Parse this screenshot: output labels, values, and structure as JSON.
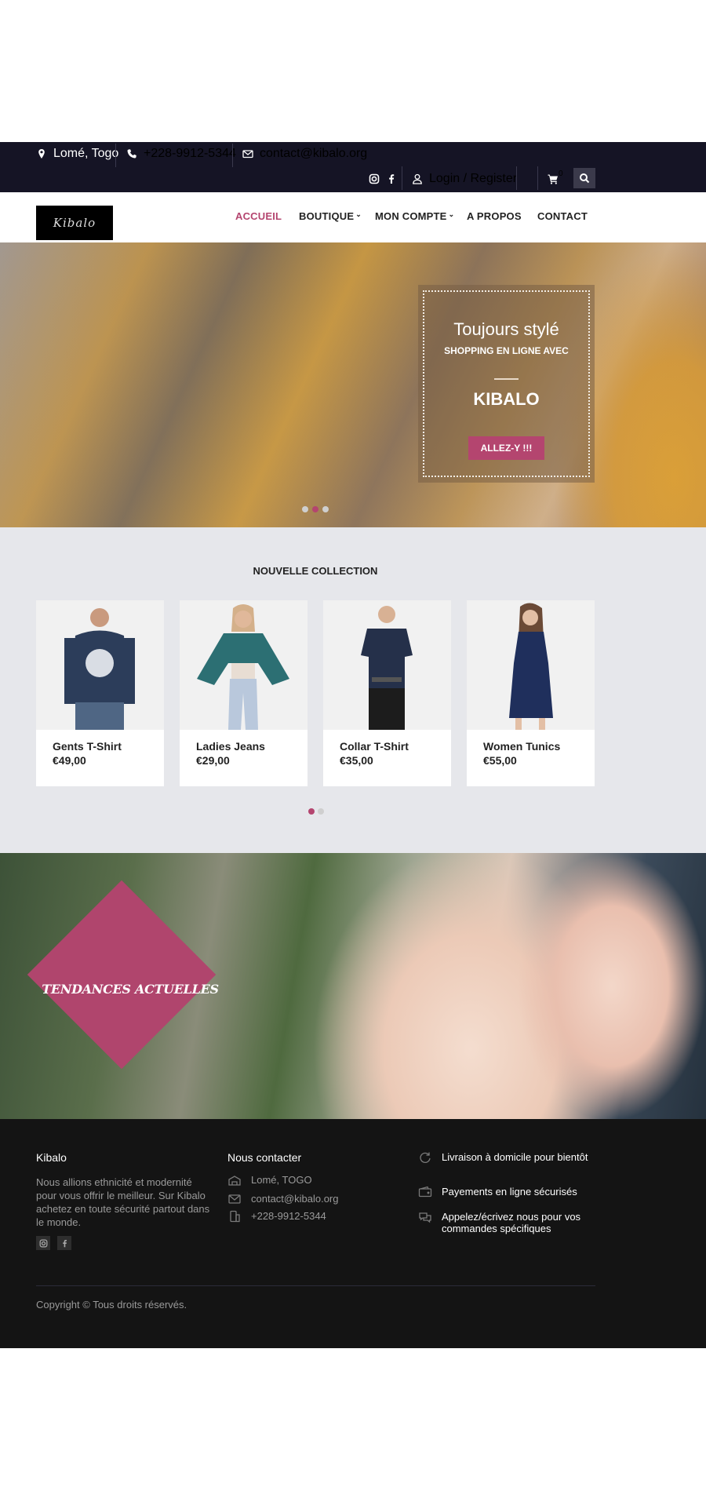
{
  "topbar": {
    "location": "Lomé, Togo",
    "phone": "+228-9912-5344",
    "email": "contact@kibalo.org",
    "login_label": "Login / Register",
    "cart_count": "0",
    "icons": [
      "map-marker-icon",
      "phone-icon",
      "envelope-icon",
      "instagram-icon",
      "facebook-icon",
      "user-icon",
      "cart-icon",
      "search-icon"
    ]
  },
  "nav": {
    "logo_text": "Kibalo",
    "items": [
      {
        "label": "ACCUEIL",
        "active": true
      },
      {
        "label": "BOUTIQUE",
        "dropdown": true
      },
      {
        "label": "MON COMPTE",
        "dropdown": true
      },
      {
        "label": "A PROPOS"
      },
      {
        "label": "CONTACT"
      }
    ],
    "accent_color": "#b4456f"
  },
  "hero": {
    "title": "Toujours stylé",
    "subtitle": "SHOPPING EN LIGNE AVEC",
    "brand": "KIBALO",
    "button_label": "ALLEZ-Y !!!",
    "slides": 3,
    "active_slide": 2
  },
  "collection": {
    "title": "NOUVELLE COLLECTION",
    "products": [
      {
        "name": "Gents T-Shirt",
        "price": "€49,00"
      },
      {
        "name": "Ladies Jeans",
        "price": "€29,00"
      },
      {
        "name": "Collar T-Shirt",
        "price": "€35,00"
      },
      {
        "name": "Women Tunics",
        "price": "€55,00"
      }
    ],
    "pages": 2,
    "active_page": 1
  },
  "trends": {
    "label": "TENDANCES ACTUELLES"
  },
  "footer": {
    "about_title": "Kibalo",
    "about_text": "Nous allions ethnicité et modernité pour vous offrir le meilleur. Sur Kibalo achetez en toute sécurité partout dans le monde.",
    "contact_title": "Nous contacter",
    "contact_address": "Lomé, TOGO",
    "contact_email": "contact@kibalo.org",
    "contact_phone": "+228-9912-5344",
    "features": [
      "Livraison à domicile pour bientôt",
      "Payements en ligne sécurisés",
      "Appelez/écrivez nous pour vos commandes spécifiques"
    ],
    "copyright": "Copyright © Tous droits réservés."
  }
}
